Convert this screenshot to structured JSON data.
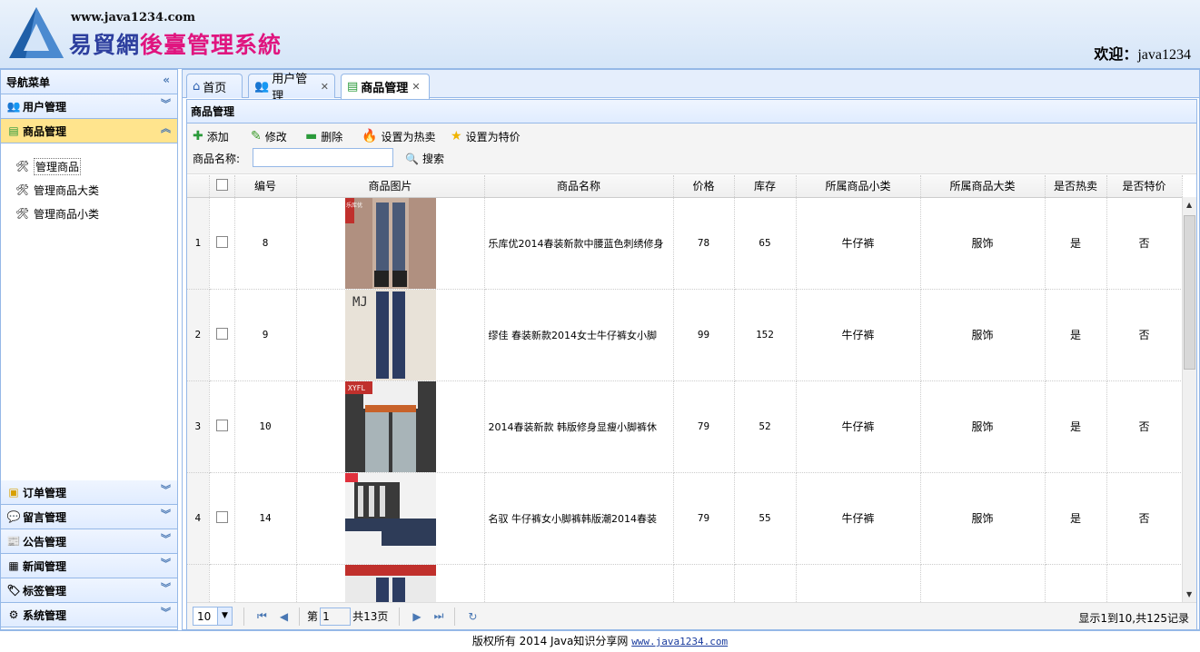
{
  "header": {
    "url": "www.java1234.com",
    "title_part1": "易貿網",
    "title_part2": "後臺管理系統",
    "welcome_label": "欢迎：",
    "welcome_user": "java1234"
  },
  "sidebar": {
    "title": "导航菜单",
    "sections": [
      {
        "label": "用户管理",
        "icon": "users-icon"
      },
      {
        "label": "商品管理",
        "icon": "grid-icon",
        "active": true
      }
    ],
    "sub_items": [
      {
        "label": "管理商品",
        "icon": "tools-icon"
      },
      {
        "label": "管理商品大类",
        "icon": "tools-icon"
      },
      {
        "label": "管理商品小类",
        "icon": "tools-icon"
      }
    ],
    "bottom_sections": [
      {
        "label": "订单管理",
        "icon": "order-icon"
      },
      {
        "label": "留言管理",
        "icon": "message-icon"
      },
      {
        "label": "公告管理",
        "icon": "notice-icon"
      },
      {
        "label": "新闻管理",
        "icon": "news-icon"
      },
      {
        "label": "标签管理",
        "icon": "tag-icon"
      },
      {
        "label": "系统管理",
        "icon": "system-icon"
      }
    ]
  },
  "tabs": [
    {
      "label": "首页",
      "icon": "home-icon"
    },
    {
      "label": "用户管理",
      "icon": "users-icon",
      "closable": true
    },
    {
      "label": "商品管理",
      "icon": "grid-icon",
      "closable": true,
      "active": true
    }
  ],
  "panel": {
    "title": "商品管理"
  },
  "toolbar": {
    "add": "添加",
    "edit": "修改",
    "delete": "删除",
    "set_hot": "设置为热卖",
    "set_special": "设置为特价",
    "search_label": "商品名称:",
    "search_value": "",
    "search_button": "搜索"
  },
  "table": {
    "columns": [
      "编号",
      "商品图片",
      "商品名称",
      "价格",
      "库存",
      "所属商品小类",
      "所属商品大类",
      "是否热卖",
      "是否特价"
    ],
    "rows": [
      {
        "rn": "1",
        "id": "8",
        "name": "乐库优2014春装新款中腰蓝色刺绣修身",
        "price": "78",
        "stock": "65",
        "small_cat": "牛仔裤",
        "big_cat": "服饰",
        "hot": "是",
        "special": "否",
        "img_tag": "乐库优"
      },
      {
        "rn": "2",
        "id": "9",
        "name": "缪佳 春装新款2014女士牛仔裤女小脚",
        "price": "99",
        "stock": "152",
        "small_cat": "牛仔裤",
        "big_cat": "服饰",
        "hot": "是",
        "special": "否",
        "img_tag": "MJ"
      },
      {
        "rn": "3",
        "id": "10",
        "name": "2014春装新款 韩版修身显瘦小脚裤休",
        "price": "79",
        "stock": "52",
        "small_cat": "牛仔裤",
        "big_cat": "服饰",
        "hot": "是",
        "special": "否",
        "img_tag": "XYFL"
      },
      {
        "rn": "4",
        "id": "14",
        "name": "名驭 牛仔裤女小脚裤韩版潮2014春装",
        "price": "79",
        "stock": "55",
        "small_cat": "牛仔裤",
        "big_cat": "服饰",
        "hot": "是",
        "special": "否",
        "img_tag": ""
      }
    ]
  },
  "pager": {
    "page_size": "10",
    "page_label_pre": "第",
    "page_value": "1",
    "page_label_post": "共13页",
    "info": "显示1到10,共125记录"
  },
  "footer": {
    "text": "版权所有 2014 Java知识分享网 ",
    "link": "www.java1234.com"
  }
}
